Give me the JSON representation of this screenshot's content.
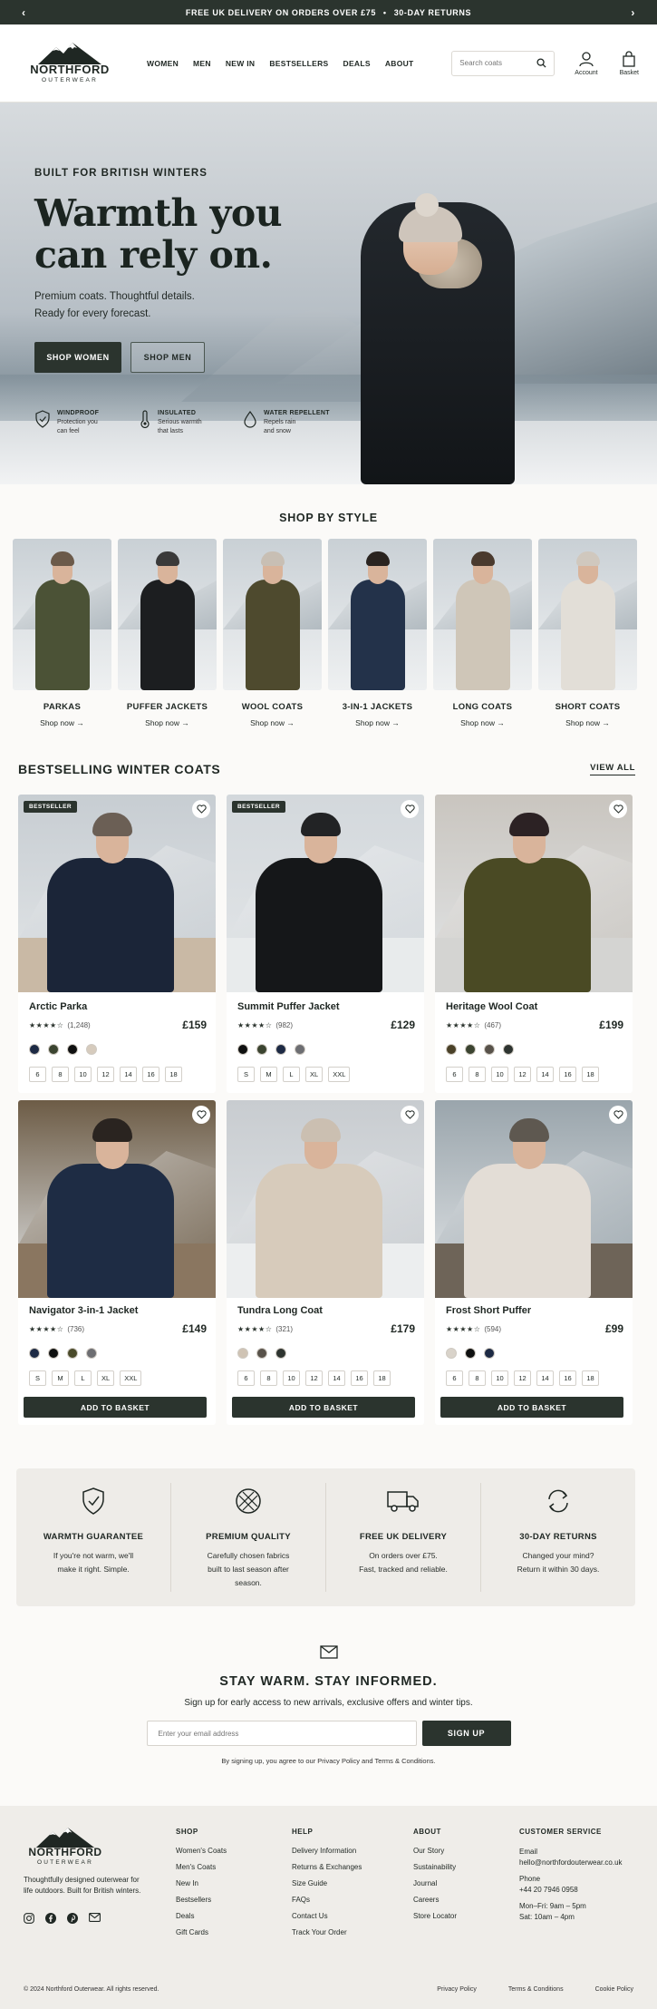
{
  "topbar": {
    "message": "FREE UK DELIVERY ON ORDERS OVER £75",
    "separator": "•",
    "message2": "30-DAY RETURNS",
    "prev": "‹",
    "next": "›"
  },
  "header": {
    "brand": "NORTHFORD",
    "brand_sub": "OUTERWEAR",
    "nav": [
      "WOMEN",
      "MEN",
      "NEW IN",
      "BESTSELLERS",
      "DEALS",
      "ABOUT"
    ],
    "search_placeholder": "Search coats",
    "account_label": "Account",
    "basket_label": "Basket"
  },
  "hero": {
    "eyebrow": "BUILT FOR BRITISH WINTERS",
    "title_line1": "Warmth you",
    "title_line2": "can rely on.",
    "desc_line1": "Premium coats. Thoughtful details.",
    "desc_line2": "Ready for every forecast.",
    "btn_women": "SHOP WOMEN",
    "btn_men": "SHOP MEN",
    "features": [
      {
        "title": "WINDPROOF",
        "line1": "Protection you",
        "line2": "can feel",
        "icon": "shield-icon"
      },
      {
        "title": "INSULATED",
        "line1": "Serious warmth",
        "line2": "that lasts",
        "icon": "thermometer-icon"
      },
      {
        "title": "WATER REPELLENT",
        "line1": "Repels rain",
        "line2": "and snow",
        "icon": "droplet-icon"
      }
    ]
  },
  "shop_by_style": {
    "title": "SHOP BY STYLE",
    "link_label": "Shop now →",
    "items": [
      {
        "name": "PARKAS",
        "coat": "#4b5236",
        "hat": "#6b5a4a"
      },
      {
        "name": "PUFFER JACKETS",
        "coat": "#1c1e20",
        "hat": "#3a3a3a"
      },
      {
        "name": "WOOL COATS",
        "coat": "#4e4a2e",
        "hat": "#c8bfb4"
      },
      {
        "name": "3-IN-1 JACKETS",
        "coat": "#23324a",
        "hat": "#2a2420"
      },
      {
        "name": "LONG COATS",
        "coat": "#cfc6b8",
        "hat": "#4a3a2e"
      },
      {
        "name": "SHORT COATS",
        "coat": "#e2ded7",
        "hat": "#d0c8be"
      }
    ]
  },
  "bestsellers": {
    "title": "BESTSELLING WINTER COATS",
    "view_all": "VIEW ALL",
    "badge": "BESTSELLER",
    "add_to_basket": "ADD TO BASKET",
    "products": [
      {
        "name": "Arctic Parka",
        "stars": "★★★★☆",
        "reviews": "(1,248)",
        "price": "£159",
        "badge": true,
        "colors": [
          "#1d2a44",
          "#3b4430",
          "#0f1010",
          "#d6cbbd"
        ],
        "sizes": [
          "6",
          "8",
          "10",
          "12",
          "14",
          "16",
          "18"
        ],
        "coat": "#1b2538",
        "hat": "#6b5f55",
        "bg": "#c7cdd2",
        "ground": "#c9b9a5"
      },
      {
        "name": "Summit Puffer Jacket",
        "stars": "★★★★☆",
        "reviews": "(982)",
        "price": "£129",
        "badge": true,
        "colors": [
          "#0f1010",
          "#3b4430",
          "#1d2a44",
          "#6d6e72"
        ],
        "sizes": [
          "S",
          "M",
          "L",
          "XL",
          "XXL"
        ],
        "coat": "#151719",
        "hat": "#222325",
        "bg": "#d3d8dc",
        "ground": "#e8ebec"
      },
      {
        "name": "Heritage Wool Coat",
        "stars": "★★★★☆",
        "reviews": "(467)",
        "price": "£199",
        "badge": false,
        "colors": [
          "#4a4128",
          "#3b4430",
          "#58524a",
          "#2e3430"
        ],
        "sizes": [
          "6",
          "8",
          "10",
          "12",
          "14",
          "16",
          "18"
        ],
        "coat": "#4a4a24",
        "hat": "#2c2224",
        "bg": "#c9c5bf",
        "ground": "#d4d4d2"
      },
      {
        "name": "Navigator 3-in-1 Jacket",
        "stars": "★★★★☆",
        "reviews": "(736)",
        "price": "£149",
        "badge": false,
        "colors": [
          "#1d2a44",
          "#0f1010",
          "#4a4a2a",
          "#6d6e72"
        ],
        "sizes": [
          "S",
          "M",
          "L",
          "XL",
          "XXL"
        ],
        "coat": "#1e2c44",
        "hat": "#2a2420",
        "bg": "#6d5c46",
        "ground": "#8a7660"
      },
      {
        "name": "Tundra Long Coat",
        "stars": "★★★★☆",
        "reviews": "(321)",
        "price": "£179",
        "badge": false,
        "colors": [
          "#cfc3b4",
          "#58524a",
          "#2e3430"
        ],
        "sizes": [
          "6",
          "8",
          "10",
          "12",
          "14",
          "16",
          "18"
        ],
        "coat": "#d7cbbb",
        "hat": "#cbbfb1",
        "bg": "#c8ccd0",
        "ground": "#eceeef"
      },
      {
        "name": "Frost Short Puffer",
        "stars": "★★★★☆",
        "reviews": "(594)",
        "price": "£99",
        "badge": false,
        "colors": [
          "#d9d3ca",
          "#0f1010",
          "#1d2a44"
        ],
        "sizes": [
          "6",
          "8",
          "10",
          "12",
          "14",
          "16",
          "18"
        ],
        "coat": "#e3ddd6",
        "hat": "#5e5850",
        "bg": "#9aa5ac",
        "ground": "#6e6458"
      }
    ]
  },
  "benefits": [
    {
      "title": "WARMTH GUARANTEE",
      "line1": "If you're not warm, we'll",
      "line2": "make it right. Simple.",
      "line3": "",
      "icon": "shield-check-icon"
    },
    {
      "title": "PREMIUM QUALITY",
      "line1": "Carefully chosen fabrics",
      "line2": "built to last season after",
      "line3": "season.",
      "icon": "fabric-icon"
    },
    {
      "title": "FREE UK DELIVERY",
      "line1": "On orders over £75.",
      "line2": "Fast, tracked and reliable.",
      "line3": "",
      "icon": "truck-icon"
    },
    {
      "title": "30-DAY RETURNS",
      "line1": "Changed your mind?",
      "line2": "Return it within 30 days.",
      "line3": "",
      "icon": "returns-icon"
    }
  ],
  "newsletter": {
    "title": "STAY WARM. STAY INFORMED.",
    "desc": "Sign up for early access to new arrivals, exclusive offers and winter tips.",
    "placeholder": "Enter your email address",
    "button": "SIGN UP",
    "note": "By signing up, you agree to our Privacy Policy and Terms & Conditions."
  },
  "footer": {
    "about": "Thoughtfully designed outerwear for life outdoors. Built for British winters.",
    "shop": {
      "title": "SHOP",
      "links": [
        "Women's Coats",
        "Men's Coats",
        "New In",
        "Bestsellers",
        "Deals",
        "Gift Cards"
      ]
    },
    "help": {
      "title": "HELP",
      "links": [
        "Delivery Information",
        "Returns & Exchanges",
        "Size Guide",
        "FAQs",
        "Contact Us",
        "Track Your Order"
      ]
    },
    "about_col": {
      "title": "ABOUT",
      "links": [
        "Our Story",
        "Sustainability",
        "Journal",
        "Careers",
        "Store Locator"
      ]
    },
    "cs": {
      "title": "CUSTOMER SERVICE",
      "email_label": "Email",
      "email": "hello@northfordouterwear.co.uk",
      "phone_label": "Phone",
      "phone": "+44 20 7946 0958",
      "hours1": "Mon–Fri: 9am – 5pm",
      "hours2": "Sat: 10am – 4pm"
    },
    "copyright": "© 2024 Northford Outerwear. All rights reserved.",
    "legal": [
      "Privacy Policy",
      "Terms & Conditions",
      "Cookie Policy"
    ]
  }
}
